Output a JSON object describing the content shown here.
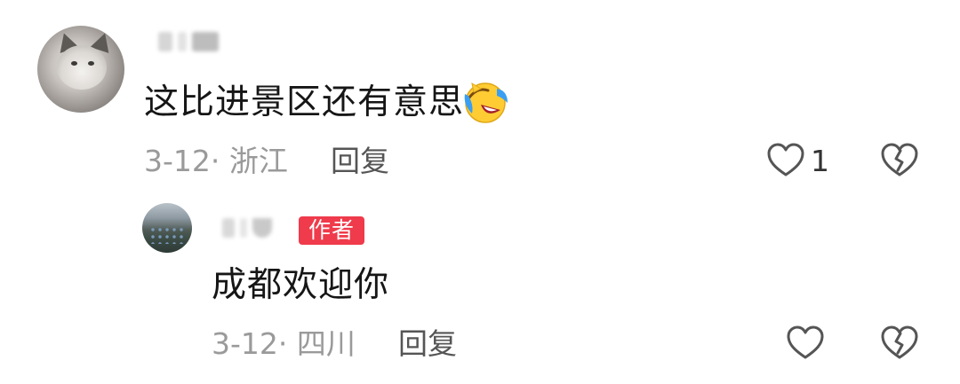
{
  "comments": [
    {
      "text": "这比进景区还有意思",
      "emoji": "tears-of-joy-emoji",
      "date": "3-12",
      "separator": "·",
      "location": "浙江",
      "reply_label": "回复",
      "like_count": "1"
    },
    {
      "badge": "作者",
      "text": "成都欢迎你",
      "date": "3-12",
      "separator": "·",
      "location": "四川",
      "reply_label": "回复"
    }
  ],
  "icons": {
    "like": "heart-outline-icon",
    "dislike": "broken-heart-icon"
  },
  "colors": {
    "author_badge": "#ef3b4b",
    "meta_text": "#9a9a9a",
    "icon_stroke": "#555555"
  }
}
